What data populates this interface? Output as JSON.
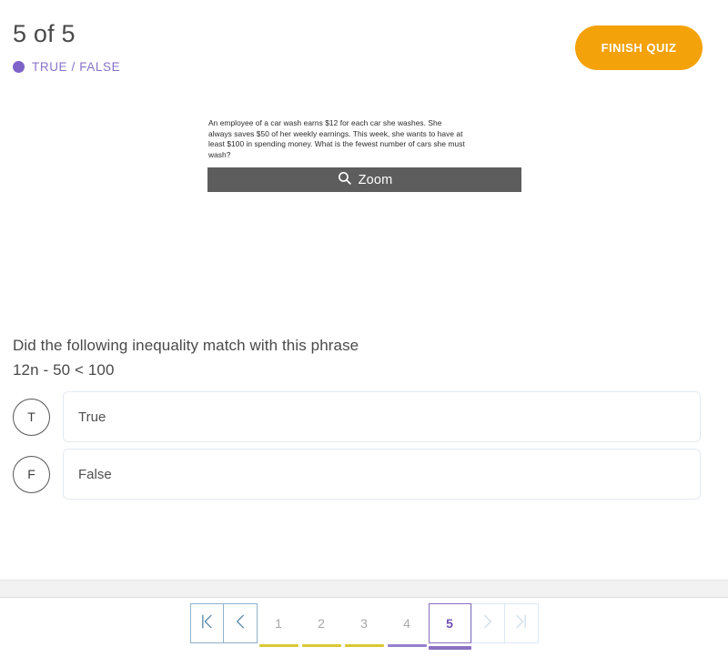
{
  "header": {
    "progress": "5 of 5",
    "question_type": "TRUE / FALSE",
    "type_dot_color": "#7d63c7",
    "finish_label": "FINISH QUIZ",
    "finish_color": "#f4a209"
  },
  "media": {
    "passage": "An employee of a car wash earns $12 for each car she washes. She always saves $50 of her weekly earnings. This week, she wants to have at least $100 in spending money. What is the fewest number of cars she must wash?",
    "zoom_label": "Zoom",
    "zoom_icon": "search-icon",
    "zoom_bar_color": "#5d5d5d"
  },
  "question": {
    "prompt": "Did the following inequality match with this phrase",
    "expression": "12n - 50 < 100"
  },
  "choices": [
    {
      "marker": "T",
      "text": "True"
    },
    {
      "marker": "F",
      "text": "False"
    }
  ],
  "pagination": {
    "first_icon": "first-page-icon",
    "prev_icon": "chevron-left-icon",
    "next_icon": "chevron-right-icon",
    "last_icon": "last-page-icon",
    "pages": [
      {
        "label": "1",
        "bar_color": "#d9c832",
        "active": false
      },
      {
        "label": "2",
        "bar_color": "#d9c832",
        "active": false
      },
      {
        "label": "3",
        "bar_color": "#d9c832",
        "active": false
      },
      {
        "label": "4",
        "bar_color": "#9480cc",
        "active": false
      },
      {
        "label": "5",
        "bar_color": "#8b6fc4",
        "active": true
      }
    ],
    "current_page": "5",
    "active_color": "#6f51b5",
    "answered_color": "#d9c832",
    "nav_enabled_color": "#8fb2cc",
    "nav_disabled_color": "#dce8f2"
  }
}
